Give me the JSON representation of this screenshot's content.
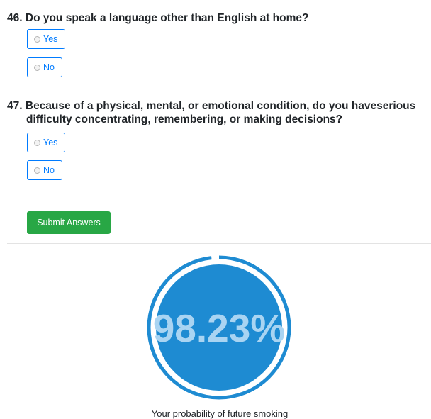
{
  "questions": [
    {
      "number": "46.",
      "text": "Do you speak a language other than English at home?",
      "options": [
        "Yes",
        "No"
      ]
    },
    {
      "number": "47.",
      "text": "Because of a physical, mental, or emotional condition, do you haveserious difficulty concentrating, remembering, or making decisions?",
      "options": [
        "Yes",
        "No"
      ]
    }
  ],
  "submit_label": "Submit Answers",
  "result": {
    "value_text": "98.23%",
    "probability_percent": 98.23,
    "caption": "Your probability of future smoking"
  },
  "colors": {
    "primary": "#007bff",
    "success": "#28a745",
    "gauge_fill": "#1e8bd2",
    "gauge_text": "#a9d4f2"
  }
}
